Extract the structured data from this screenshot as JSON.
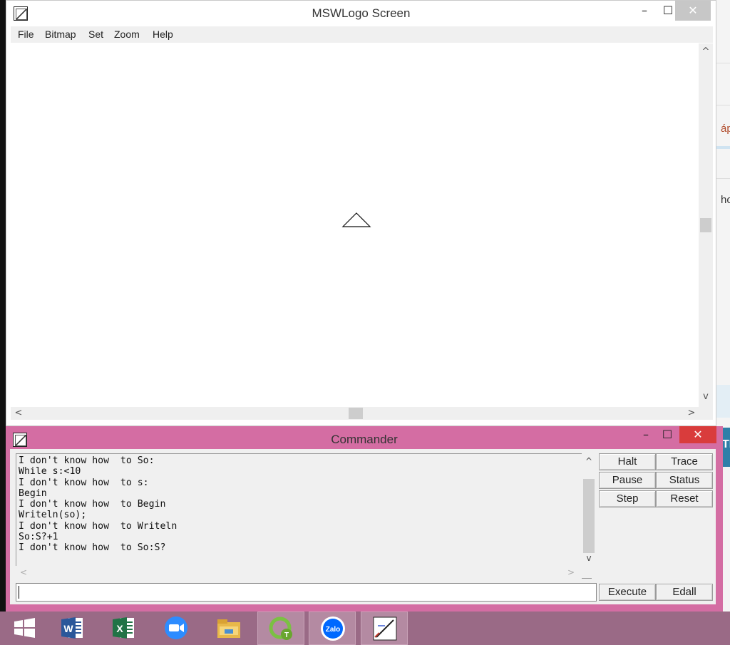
{
  "main_window": {
    "title": "MSWLogo Screen",
    "icon": "mswlogo-app-icon",
    "controls": {
      "minimize": "–",
      "maximize": "☐",
      "close": "✕"
    },
    "menu": [
      "File",
      "Bitmap",
      "Set",
      "Zoom",
      "Help"
    ]
  },
  "scroll_glyphs": {
    "up": "^",
    "down": "v",
    "left": "<",
    "right": ">"
  },
  "commander": {
    "title": "Commander",
    "controls": {
      "minimize": "–",
      "maximize": "☐",
      "close": "✕"
    },
    "output_lines": [
      "I don't know how  to So:",
      "While s:<10",
      "I don't know how  to s:",
      "Begin",
      "I don't know how  to Begin",
      "Writeln(so);",
      "I don't know how  to Writeln",
      "So:S?+1",
      "I don't know how  to So:S?"
    ],
    "buttons": {
      "halt": "Halt",
      "trace": "Trace",
      "pause": "Pause",
      "status": "Status",
      "step": "Step",
      "reset": "Reset",
      "execute": "Execute",
      "edall": "Edall"
    },
    "input_value": ""
  },
  "background_window": {
    "text_1": "áp",
    "text_2": "ho",
    "text_3": "TI"
  },
  "taskbar": {
    "items": [
      {
        "icon": "windows-start-icon",
        "active": false
      },
      {
        "icon": "word-icon",
        "active": false
      },
      {
        "icon": "excel-icon",
        "active": false
      },
      {
        "icon": "zoom-icon",
        "active": false
      },
      {
        "icon": "file-explorer-icon",
        "active": false
      },
      {
        "icon": "green-app-icon",
        "active": true
      },
      {
        "icon": "zalo-icon",
        "active": true,
        "label": "Zalo"
      },
      {
        "icon": "mswlogo-icon",
        "active": true
      }
    ]
  },
  "colors": {
    "commander_frame": "#d46da3",
    "close_button_active": "#d93c3c",
    "taskbar": "#9a6a86"
  }
}
